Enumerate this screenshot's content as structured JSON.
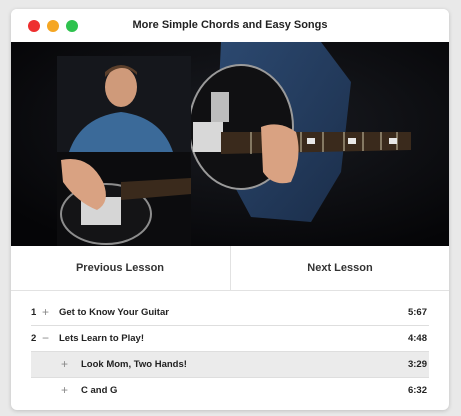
{
  "window": {
    "title": "More Simple Chords and Easy Songs",
    "controls": {
      "close_color": "#ee2f2f",
      "minimize_color": "#f5a623",
      "maximize_color": "#2ec24e"
    }
  },
  "navigation": {
    "previous_label": "Previous Lesson",
    "next_label": "Next Lesson"
  },
  "lessons": [
    {
      "number": "1",
      "toggle": "+",
      "title": "Get to Know Your Guitar",
      "duration": "5:67"
    },
    {
      "number": "2",
      "toggle": "−",
      "title": "Lets Learn to Play!",
      "duration": "4:48"
    },
    {
      "number": "",
      "toggle": "+",
      "title": "Look Mom, Two Hands!",
      "duration": "3:29",
      "selected": true
    },
    {
      "number": "",
      "toggle": "+",
      "title": "C and G",
      "duration": "6:32"
    }
  ]
}
